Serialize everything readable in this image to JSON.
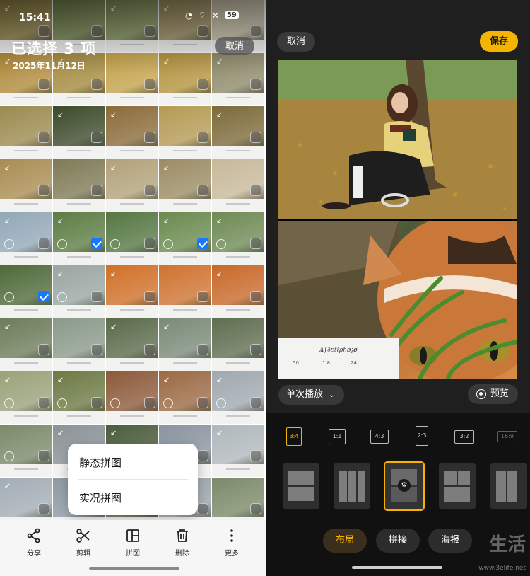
{
  "status": {
    "time": "15:41",
    "battery": "59"
  },
  "selection": {
    "title": "已选择 3 项",
    "date": "2025年11月12日",
    "cancel_label": "取消"
  },
  "popup": {
    "items": [
      "静态拼图",
      "实况拼图"
    ]
  },
  "bottom_toolbar": {
    "items": [
      {
        "label": "分享",
        "icon": "share-icon"
      },
      {
        "label": "剪辑",
        "icon": "scissors-icon"
      },
      {
        "label": "拼图",
        "icon": "collage-icon"
      },
      {
        "label": "删除",
        "icon": "trash-icon"
      },
      {
        "label": "更多",
        "icon": "more-vertical-icon"
      }
    ]
  },
  "editor": {
    "cancel_label": "取消",
    "save_label": "保存",
    "play_mode_label": "单次播放",
    "preview_label": "预览",
    "photo_stats": [
      "50",
      "1.8",
      "24"
    ],
    "ratios": [
      "3:4",
      "1:1",
      "4:3",
      "2:3",
      "3:2",
      "16:9"
    ],
    "selected_ratio": "3:4",
    "tabs": [
      "布局",
      "拼接",
      "海报"
    ],
    "active_tab": "布局"
  },
  "grid": {
    "selected_cells": [
      21,
      23,
      25
    ],
    "colors": [
      "#8a7a3c",
      "#6d7e45",
      "#7c8c52",
      "#9a8a5a",
      "#c9c1a6",
      "#b08a3b",
      "#a48a3e",
      "#c4a24b",
      "#b3933f",
      "#8f8a6a",
      "#9c8a4f",
      "#3c4a2a",
      "#8b6b3a",
      "#b49a54",
      "#7c6a3a",
      "#a98d52",
      "#7f7a56",
      "#b2a27a",
      "#9b8c64",
      "#c7b99a",
      "#93a8b8",
      "#5d7d44",
      "#557743",
      "#6a8a4e",
      "#6f8a55",
      "#4f6a3a",
      "#9aa6a2",
      "#d07028",
      "#cf7330",
      "#c8692a",
      "#6d7d5a",
      "#8a9a8a",
      "#5a6a4a",
      "#7a8a78",
      "#5f6e50",
      "#9aa27a",
      "#6c7a44",
      "#8c5a3a",
      "#9a6a44",
      "#a0a9b0",
      "#7a8a6a",
      "#8a9296",
      "#4a5c3c",
      "#8a94a0",
      "#b0b8bc",
      "#a3adb5",
      "#8f9aa3",
      "#5a6f48",
      "#9aa4aa",
      "#7b8a6a"
    ]
  }
}
